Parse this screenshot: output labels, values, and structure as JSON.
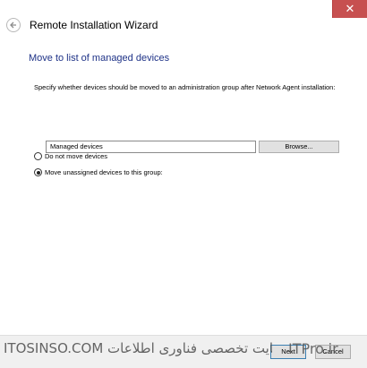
{
  "window": {
    "title": "Remote Installation Wizard",
    "close_glyph": "✕",
    "back_icon": "back-arrow-icon"
  },
  "page": {
    "title": "Move to list of managed devices",
    "instruction": "Specify whether devices should be moved to an administration group after Network Agent installation:"
  },
  "options": [
    {
      "label": "Do not move devices",
      "checked": false
    },
    {
      "label": "Move unassigned devices to this group:",
      "checked": true
    }
  ],
  "group_field": {
    "value": "Managed devices"
  },
  "buttons": {
    "browse": "Browse...",
    "next": "Next",
    "cancel": "Cancel"
  },
  "watermark": {
    "left": "ITOSINSO.COM وب سایت تخصصی فناوری اطلاعات",
    "right": "ITPro.ir"
  },
  "colors": {
    "page_title": "#1e3287",
    "close_button": "#c75050",
    "footer": "#f0f0f0"
  }
}
